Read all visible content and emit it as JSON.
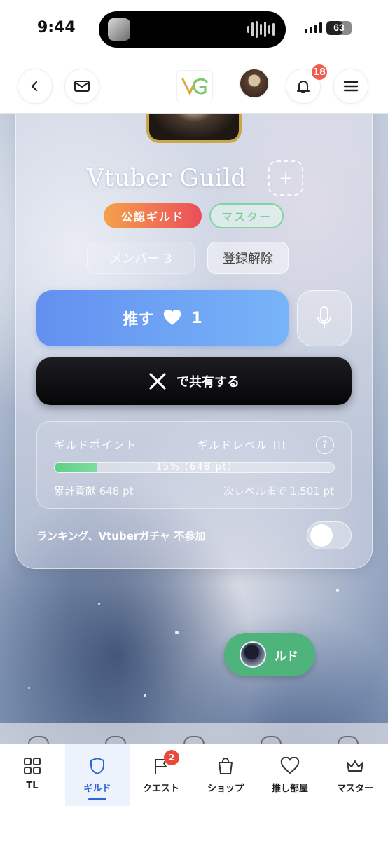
{
  "status_bar": {
    "time": "9:44",
    "battery": "63"
  },
  "top_nav": {
    "notification_count": "18"
  },
  "guild": {
    "name": "Vtuber Guild",
    "add_symbol": "+",
    "badge_official": "公認ギルド",
    "badge_master": "マスター",
    "members_label": "メンバー 3",
    "unregister_label": "登録解除",
    "oshi_label": "推す",
    "oshi_count": "1",
    "share_label": "で共有する"
  },
  "points": {
    "guild_points_label": "ギルドポイント",
    "guild_level_label": "ギルドレベル III",
    "help_symbol": "?",
    "progress_percent": 15,
    "progress_text": "15% (648 pt)",
    "contribution": "累計貢献 648 pt",
    "next_level": "次レベルまで 1,501 pt"
  },
  "ranking": {
    "label": "ランキング、Vtuberガチャ 不参加",
    "enabled": false
  },
  "fab": {
    "label": "ルド"
  },
  "tabs": [
    {
      "label": "TL",
      "icon": "grid-icon"
    },
    {
      "label": "ギルド",
      "icon": "shield-icon",
      "active": true
    },
    {
      "label": "クエスト",
      "icon": "flag-icon",
      "badge": "2"
    },
    {
      "label": "ショップ",
      "icon": "shopping-bag-icon"
    },
    {
      "label": "推し部屋",
      "icon": "heart-icon"
    },
    {
      "label": "マスター",
      "icon": "crown-icon"
    }
  ],
  "colors": {
    "accent": "#2f63d8",
    "oshi_start": "#6390f0",
    "oshi_end": "#78b4f8",
    "success": "#5fcf86",
    "badge": "#ef5b4c"
  }
}
